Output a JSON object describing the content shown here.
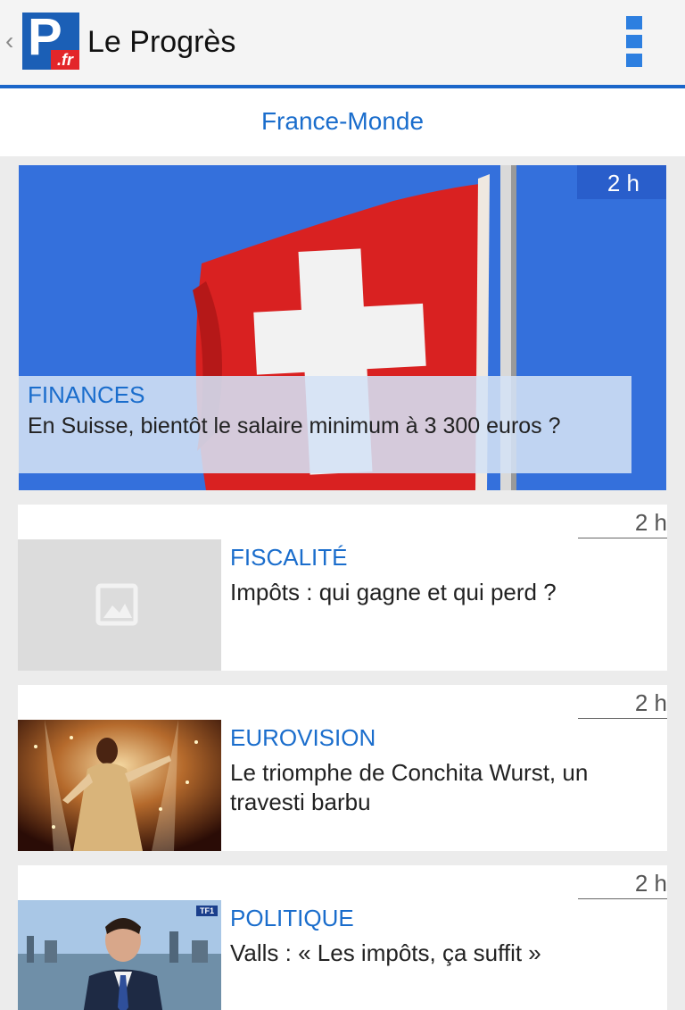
{
  "app": {
    "back_glyph": "‹",
    "logo_letter": "P",
    "logo_suffix": ".fr",
    "title": "Le Progrès",
    "accent_color": "#1b66c9"
  },
  "section": {
    "label": "France-Monde"
  },
  "hero": {
    "time": "2 h",
    "category": "FINANCES",
    "headline": "En Suisse, bientôt le salaire minimum  à 3 300 euros ?"
  },
  "articles": [
    {
      "time": "2 h",
      "category": "FISCALITÉ",
      "headline": "Impôts : qui gagne et qui perd ?",
      "image": "placeholder-icon"
    },
    {
      "time": "2 h",
      "category": "EUROVISION",
      "headline": "Le triomphe de Conchita Wurst, un travesti barbu",
      "image": "stage-photo"
    },
    {
      "time": "2 h",
      "category": "POLITIQUE",
      "headline": "Valls : « Les impôts, ça suffit »",
      "image": "tv-photo",
      "image_badge": "TF1"
    }
  ]
}
